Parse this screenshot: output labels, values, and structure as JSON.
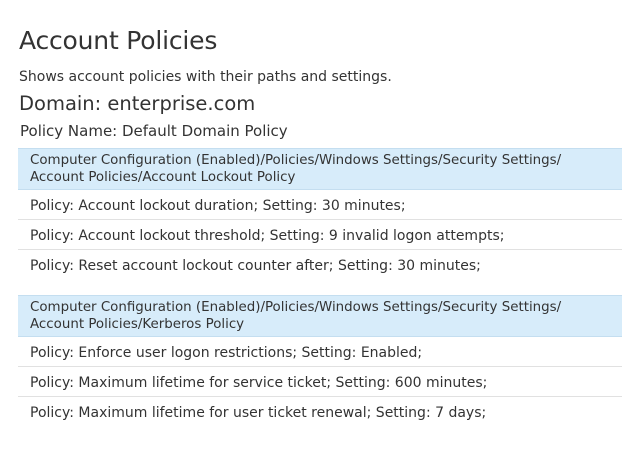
{
  "page": {
    "title": "Account Policies",
    "description": "Shows account policies with their paths and settings."
  },
  "domain": {
    "label": "Domain: enterprise.com"
  },
  "policy": {
    "label": "Policy Name: Default Domain Policy"
  },
  "sections": [
    {
      "path_line1": "Computer Configuration (Enabled)/Policies/Windows Settings/Security Settings/",
      "path_line2": "Account Policies/Account Lockout Policy",
      "rows": [
        "Policy: Account lockout duration; Setting: 30 minutes;",
        "Policy: Account lockout threshold; Setting: 9 invalid logon attempts;",
        "Policy: Reset account lockout counter after; Setting: 30 minutes;"
      ]
    },
    {
      "path_line1": "Computer Configuration (Enabled)/Policies/Windows Settings/Security Settings/",
      "path_line2": "Account Policies/Kerberos Policy",
      "rows": [
        "Policy: Enforce user logon restrictions; Setting: Enabled;",
        "Policy: Maximum lifetime for service ticket; Setting: 600 minutes;",
        "Policy: Maximum lifetime for user ticket renewal; Setting: 7 days;"
      ]
    }
  ],
  "colors": {
    "section_header_bg": "#d7ecfa",
    "text": "#333333",
    "row_divider": "#e1e1e1"
  }
}
